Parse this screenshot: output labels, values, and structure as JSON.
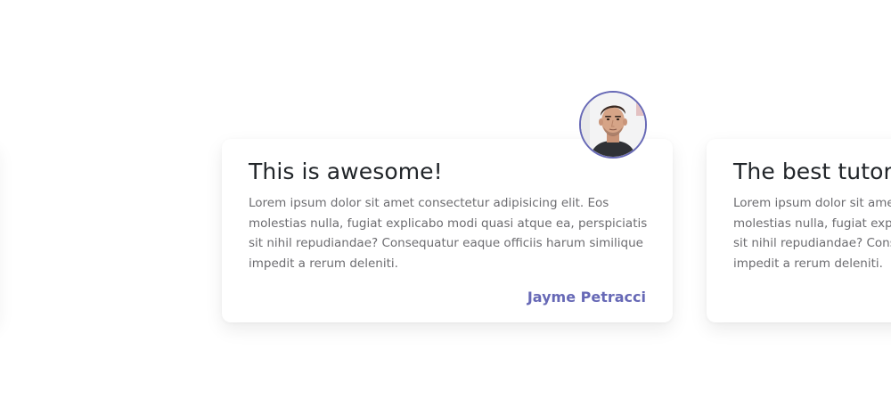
{
  "testimonials": [
    {
      "title": "This is awesome!",
      "text": "Lorem ipsum dolor sit amet consectetur adipisicing elit. Eos molestias nulla, fugiat explicabo modi quasi atque ea, perspiciatis sit nihil repudiandae? Consequatur eaque officiis harum similique impedit a rerum deleniti.",
      "author": "Jayme Petracci"
    },
    {
      "title": "The best tutor",
      "text": "Lorem ipsum dolor sit amet consectetur adipisicing elit. Eos molestias nulla, fugiat explicabo modi quasi atque ea, perspiciatis sit nihil repudiandae? Consequatur eaque officiis harum similique impedit a rerum deleniti."
    }
  ],
  "colors": {
    "accent": "#6769b6",
    "title": "#212529",
    "body_text": "#6c6c70",
    "background": "#ffffff"
  }
}
